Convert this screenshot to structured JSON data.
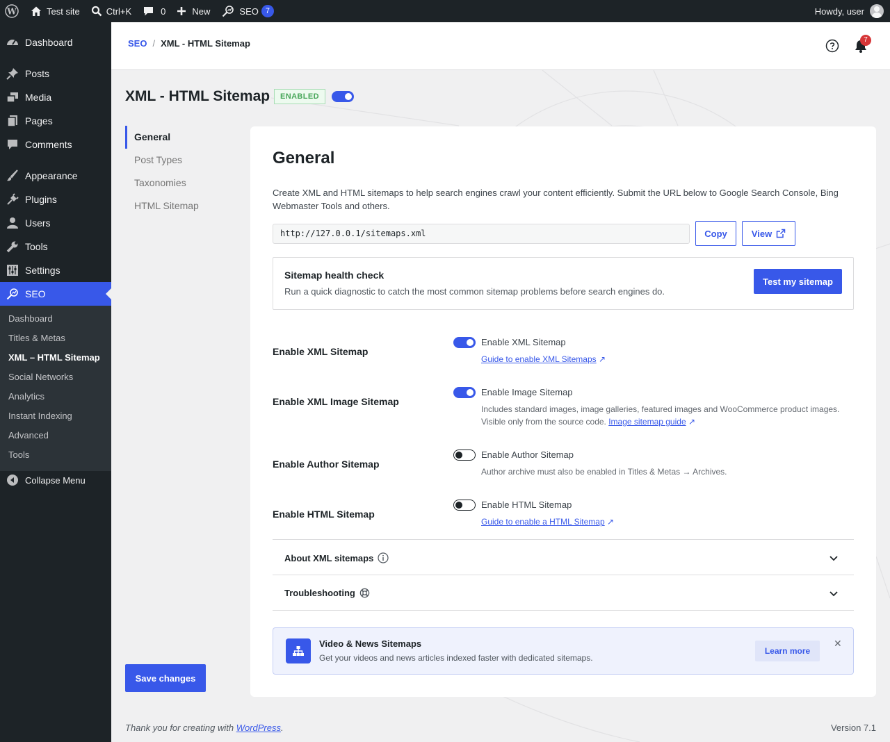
{
  "admin_bar": {
    "site_name": "Test site",
    "search_shortcut": "Ctrl+K",
    "comments_count": "0",
    "new_label": "New",
    "seo_label": "SEO",
    "seo_badge": "7",
    "howdy": "Howdy, user"
  },
  "sidebar": {
    "items": [
      {
        "label": "Dashboard",
        "icon": "dashboard-icon"
      },
      {
        "label": "Posts",
        "icon": "pin-icon"
      },
      {
        "label": "Media",
        "icon": "media-icon"
      },
      {
        "label": "Pages",
        "icon": "pages-icon"
      },
      {
        "label": "Comments",
        "icon": "comment-icon"
      },
      {
        "label": "Appearance",
        "icon": "brush-icon"
      },
      {
        "label": "Plugins",
        "icon": "plug-icon"
      },
      {
        "label": "Users",
        "icon": "user-icon"
      },
      {
        "label": "Tools",
        "icon": "wrench-icon"
      },
      {
        "label": "Settings",
        "icon": "sliders-icon"
      },
      {
        "label": "SEO",
        "icon": "seo-icon"
      }
    ],
    "submenu": [
      "Dashboard",
      "Titles & Metas",
      "XML – HTML Sitemap",
      "Social Networks",
      "Analytics",
      "Instant Indexing",
      "Advanced",
      "Tools"
    ],
    "collapse": "Collapse Menu"
  },
  "header": {
    "breadcrumb_root": "SEO",
    "breadcrumb_separator": "/",
    "breadcrumb_current": "XML - HTML Sitemap",
    "notifications_count": "7"
  },
  "page": {
    "title": "XML - HTML Sitemap",
    "status": "ENABLED",
    "module_enabled": true
  },
  "tabs": [
    "General",
    "Post Types",
    "Taxonomies",
    "HTML Sitemap"
  ],
  "general": {
    "title": "General",
    "description": "Create XML and HTML sitemaps to help search engines crawl your content efficiently. Submit the URL below to Google Search Console, Bing Webmaster Tools and others.",
    "sitemap_url": "http://127.0.0.1/sitemaps.xml",
    "copy_label": "Copy",
    "view_label": "View",
    "health_title": "Sitemap health check",
    "health_desc": "Run a quick diagnostic to catch the most common sitemap problems before search engines do.",
    "health_button": "Test my sitemap"
  },
  "options": [
    {
      "label": "Enable XML Sitemap",
      "checkbox": "Enable XML Sitemap",
      "enabled": true,
      "link": "Guide to enable XML Sitemaps"
    },
    {
      "label": "Enable XML Image Sitemap",
      "checkbox": "Enable Image Sitemap",
      "enabled": true,
      "desc": "Includes standard images, image galleries, featured images and WooCommerce product images. Visible only from the source code.",
      "link": "Image sitemap guide"
    },
    {
      "label": "Enable Author Sitemap",
      "checkbox": "Enable Author Sitemap",
      "enabled": false,
      "desc": "Author archive must also be enabled in Titles & Metas → Archives."
    },
    {
      "label": "Enable HTML Sitemap",
      "checkbox": "Enable HTML Sitemap",
      "enabled": false,
      "link": "Guide to enable a HTML Sitemap"
    }
  ],
  "link_arrow": "↗",
  "accordions": [
    {
      "title": "About XML sitemaps"
    },
    {
      "title": "Troubleshooting"
    }
  ],
  "promo": {
    "title": "Video & News Sitemaps",
    "desc": "Get your videos and news articles indexed faster with dedicated sitemaps.",
    "button": "Learn more",
    "close": "✕"
  },
  "save_label": "Save changes",
  "footer": {
    "thanks_prefix": "Thank you for creating with ",
    "thanks_link": "WordPress",
    "thanks_suffix": ".",
    "version": "Version 7.1"
  },
  "colors": {
    "accent": "#3858e9",
    "adminbar": "#1d2327",
    "enabled_green": "#46a558",
    "notification_red": "#d63638"
  }
}
